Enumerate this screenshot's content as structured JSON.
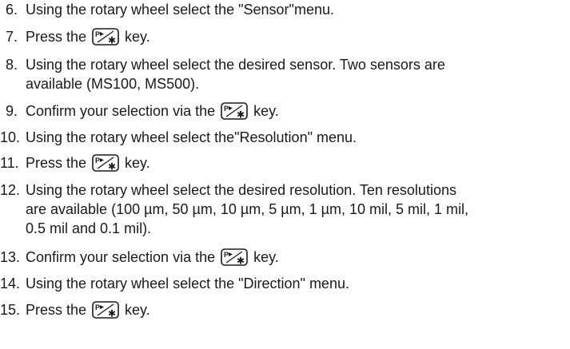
{
  "steps": [
    {
      "number": "6.",
      "lines": [
        "Using the rotary wheel select the \"Sensor\"menu."
      ]
    },
    {
      "number": "7.",
      "before": "Press the",
      "key_icon": "p-star-key-icon",
      "after": "key."
    },
    {
      "number": "8.",
      "lines": [
        "Using the rotary wheel select the desired sensor. Two sensors are",
        "available (MS100, MS500)."
      ]
    },
    {
      "number": "9.",
      "before": "Confirm your selection via the",
      "key_icon": "p-star-key-icon",
      "after": "key."
    },
    {
      "number": "10.",
      "lines": [
        "Using the rotary wheel select the\"Resolution\" menu."
      ]
    },
    {
      "number": "11.",
      "before": "Press the",
      "key_icon": "p-star-key-icon",
      "after": "key."
    },
    {
      "number": "12.",
      "lines": [
        "Using the rotary wheel select the desired resolution. Ten resolutions",
        "are available (100 µm, 50 µm, 10 µm, 5 µm, 1 µm, 10 mil, 5 mil, 1 mil,",
        "0.5 mil and 0.1 mil)."
      ]
    },
    {
      "number": "13.",
      "before": "Confirm your selection via the",
      "key_icon": "p-star-key-icon",
      "after": "key."
    },
    {
      "number": "14.",
      "lines": [
        "Using the rotary wheel select the \"Direction\" menu."
      ]
    },
    {
      "number": "15.",
      "before": "Press the",
      "key_icon": "p-star-key-icon",
      "after": "key."
    }
  ]
}
